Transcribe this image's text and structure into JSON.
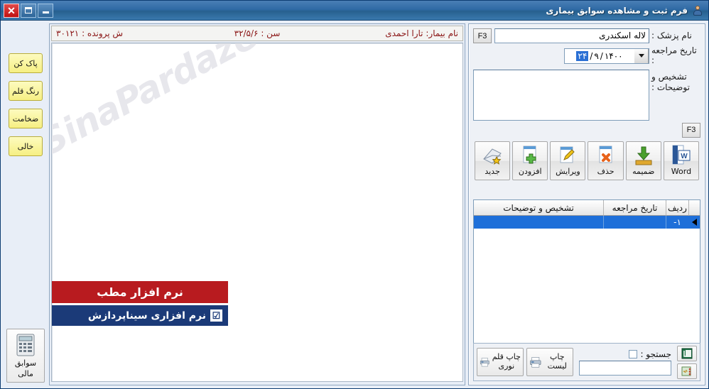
{
  "window": {
    "title": "فرم ثبت و مشاهده سوابق بیماری",
    "icon": "user-icon",
    "minimize_label": "",
    "maximize_label": "",
    "close_label": "✕"
  },
  "form": {
    "doctor_label": "نام پزشک :",
    "doctor_value": "لاله اسکندری",
    "doctor_f3": "F3",
    "date_label": "تاریخ مراجعه :",
    "date_day": "۲۴",
    "date_month": "۹",
    "date_year": "۱۴۰۰",
    "date_sep": "/",
    "memo_label": "تشخیص و توضیحات :",
    "memo_value": "",
    "memo_f3": "F3"
  },
  "toolbar": {
    "buttons": [
      {
        "label": "Word",
        "icon": "word-document-icon"
      },
      {
        "label": "ضمیمه",
        "icon": "attach-download-icon"
      },
      {
        "label": "حذف",
        "icon": "delete-document-icon"
      },
      {
        "label": "ویرایش",
        "icon": "edit-pencil-icon"
      },
      {
        "label": "افزودن",
        "icon": "add-document-icon"
      },
      {
        "label": "جدید",
        "icon": "new-book-icon"
      }
    ]
  },
  "grid": {
    "headers": [
      "ردیف",
      "تاریخ مراجعه",
      "تشخیص و توضیحات"
    ],
    "rows": [
      {
        "row_no": "۱-",
        "date": "",
        "description": "",
        "selected": true
      }
    ]
  },
  "scrollbar": {
    "left_arrow": "‹",
    "right_arrow": "›"
  },
  "bottom": {
    "print_pen_label": "چاپ قلم نوری",
    "print_list_label": "چاپ لیست",
    "search_label": "جستجو :",
    "search_value": "",
    "search_checked": false,
    "export_icon": "excel-export-icon",
    "export_detail_icon": "excel-detail-export-icon"
  },
  "patient": {
    "name_label": "نام بیمار:",
    "name_value": "تارا احمدی",
    "age_label": "سن :",
    "age_value": "۳۲/۵/۶",
    "file_label": "ش پرونده :",
    "file_value": "۳۰۱۲۱"
  },
  "canvas": {
    "watermark": "SinaPardazeshSoft"
  },
  "brand": {
    "red_text": "نرم افزار مطب",
    "blue_text": "نرم افزاری سیناپردازش",
    "logo_glyph": "☑"
  },
  "tools": {
    "buttons": [
      {
        "label": "پاک کن"
      },
      {
        "label": "رنگ قلم"
      },
      {
        "label": "ضخامت"
      },
      {
        "label": "خالی"
      }
    ],
    "finance_label_1": "سوابق",
    "finance_label_2": "مالی",
    "finance_icon": "calculator-icon"
  },
  "colors": {
    "titlebar": "#2f6aa5",
    "brand_red": "#b81b1f",
    "brand_blue": "#1b3a78",
    "patient_text": "#8a1414",
    "selection_blue": "#1e6fd9",
    "tool_yellow": "#f6ef83"
  }
}
